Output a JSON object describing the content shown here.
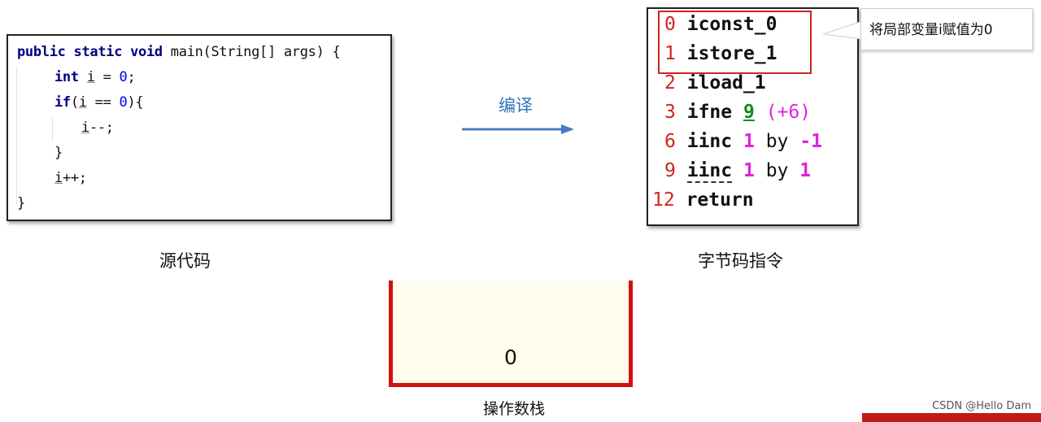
{
  "source_code": {
    "caption": "源代码",
    "lines": [
      {
        "parts": [
          "public static void ",
          "main(String[] args) {"
        ]
      },
      {
        "parts": [
          "int",
          " ",
          "i",
          " = ",
          "0",
          ";"
        ]
      },
      {
        "parts": [
          "if",
          "(",
          "i",
          " == ",
          "0",
          "){"
        ]
      },
      {
        "parts": [
          "i",
          "--;"
        ]
      },
      {
        "parts": [
          "}"
        ]
      },
      {
        "parts": [
          "i",
          "++;"
        ]
      },
      {
        "parts": [
          "}"
        ]
      }
    ]
  },
  "compile": {
    "label": "编译"
  },
  "bytecode": {
    "caption": "字节码指令",
    "instructions": [
      {
        "index": "0",
        "op": "iconst_0"
      },
      {
        "index": "1",
        "op": "istore_1"
      },
      {
        "index": "2",
        "op": "iload_1"
      },
      {
        "index": "3",
        "op": "ifne",
        "target": "9",
        "offset": "(+6)"
      },
      {
        "index": "6",
        "op": "iinc",
        "a": "1",
        "by": "by",
        "b": "-1"
      },
      {
        "index": "9",
        "op": "iinc",
        "a": "1",
        "by": "by",
        "b": "1"
      },
      {
        "index": "12",
        "op": "return"
      }
    ],
    "callout": "将局部变量i赋值为0"
  },
  "operand_stack": {
    "caption": "操作数栈",
    "values": [
      "0"
    ]
  },
  "watermark": "CSDN @Hello Dam",
  "colors": {
    "keyword": "#000080",
    "number": "#0000ff",
    "index": "#d0241c",
    "highlight": "#d0241c",
    "arg": "#e022e0",
    "target": "#1a8a1a",
    "compile": "#2e75b6",
    "stack_border": "#d40f0f",
    "stack_fill": "#fffdee"
  }
}
